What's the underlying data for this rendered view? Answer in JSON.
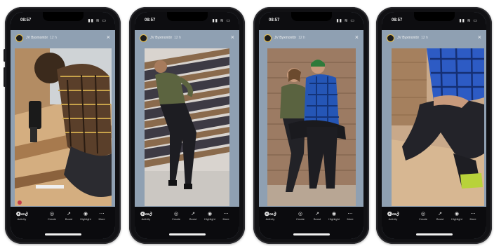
{
  "status_bar": {
    "time": "08:57",
    "signal": "▮▮ ≋ ▭"
  },
  "story": {
    "account": "JV Byxmontör",
    "timestamp": "12 h",
    "close_glyph": "×"
  },
  "bottom_bar": {
    "brand_glyph": "❂ ∞ ∂",
    "brand_label": "Activity",
    "items": [
      {
        "icon": "◎",
        "label": "Create"
      },
      {
        "icon": "↗",
        "label": "Boost"
      },
      {
        "icon": "◉",
        "label": "Highlight"
      },
      {
        "icon": "⋯",
        "label": "More"
      }
    ]
  },
  "stories": [
    {
      "subject": "man kneeling with power drill on wooden floor",
      "colors": {
        "bg": "#8fa0b2",
        "photo": "#c9a27a",
        "accent": "#3a2a1c"
      }
    },
    {
      "subject": "man standing beside stacked wooden pallets",
      "colors": {
        "bg": "#8fa0b2",
        "photo": "#7e6a58",
        "accent": "#3e4a2e"
      }
    },
    {
      "subject": "couple posing against wooden wall",
      "colors": {
        "bg": "#8fa0b2",
        "photo": "#a4826a",
        "accent": "#1f4fa8"
      }
    },
    {
      "subject": "person in blue flannel shirt kneeling, close-up of trousers",
      "colors": {
        "bg": "#8fa0b2",
        "photo": "#cba98b",
        "accent": "#2d5bc4"
      }
    }
  ]
}
